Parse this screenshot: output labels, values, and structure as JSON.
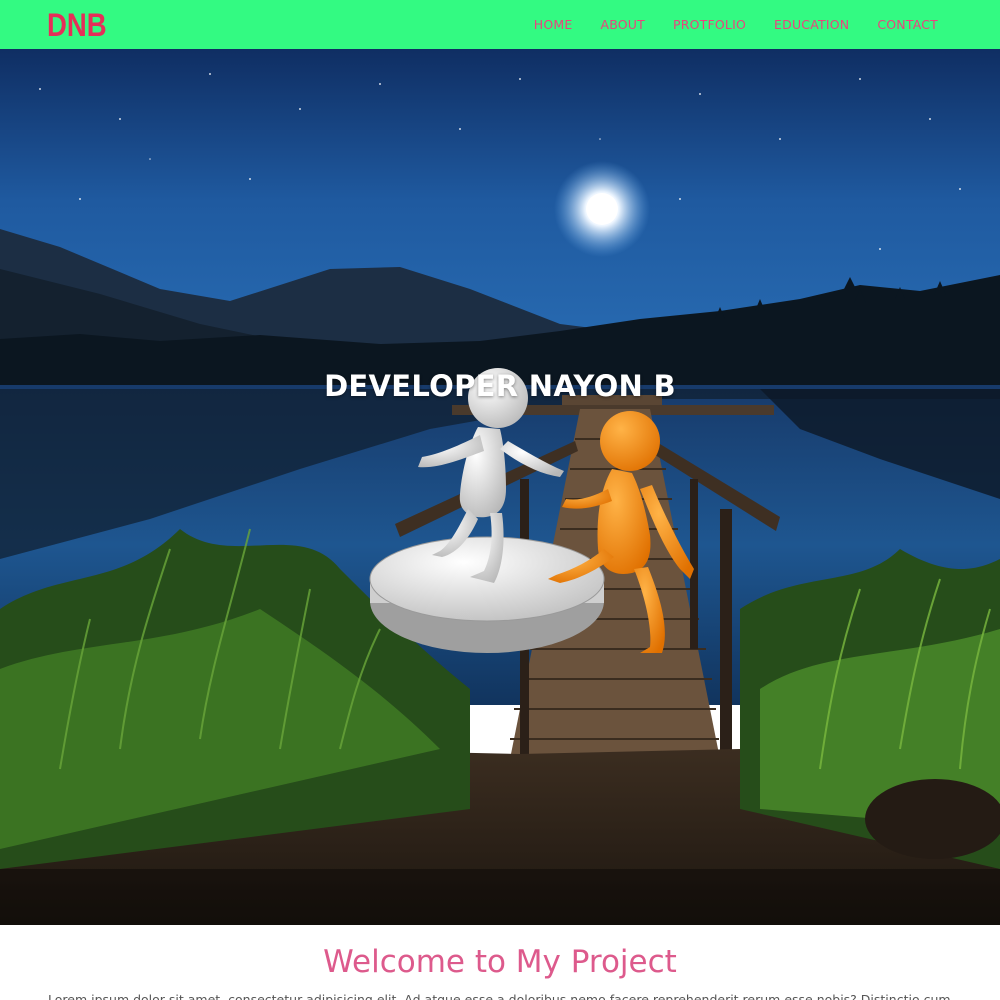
{
  "nav": {
    "logo": "DNB",
    "links": [
      "HOME",
      "ABOUT",
      "PROTFOLIO",
      "EDUCATION",
      "CONTACT"
    ]
  },
  "hero": {
    "title": "DEVELOPER NAYON B",
    "image": "night-lake-dock-with-3d-figures-illustration"
  },
  "welcome": {
    "heading": "Welcome to My Project",
    "body": "Lorem ipsum dolor sit amet, consectetur adipisicing elit. Ad atque esse a doloribus nemo facere reprehenderit rerum esse nobis? Distinctio cum"
  },
  "colors": {
    "nav_bg": "#33fa82",
    "logo": "#e62e58",
    "nav_link": "#e8457e",
    "heading": "#dd5a8c",
    "sky": "#1d4f8f"
  }
}
